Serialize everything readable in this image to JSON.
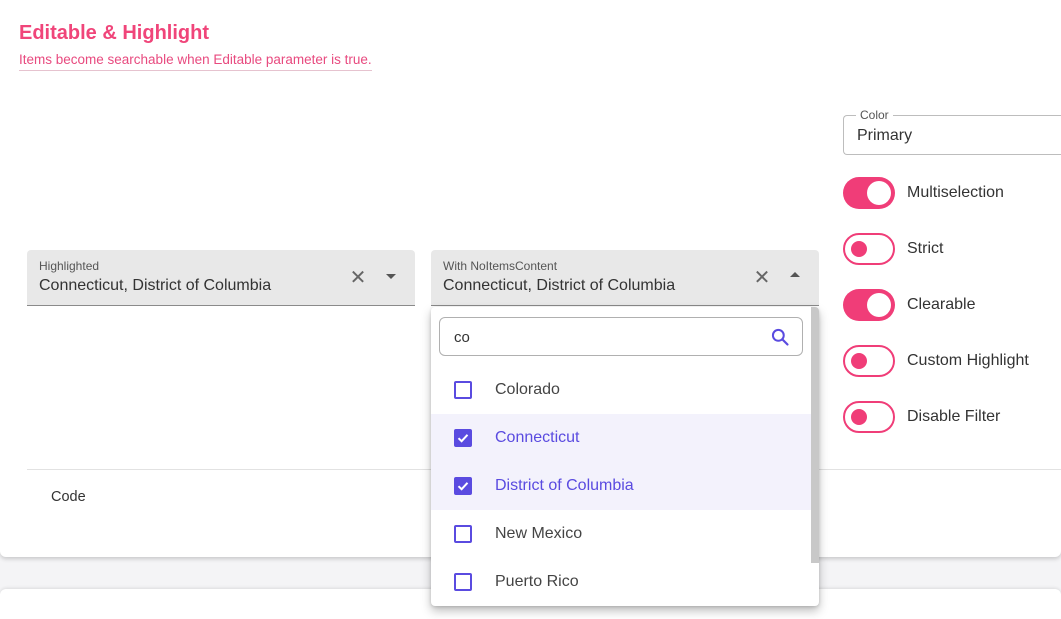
{
  "header": {
    "title": "Editable & Highlight",
    "subtitle": "Items become searchable when Editable parameter is true."
  },
  "fields": {
    "highlighted": {
      "label": "Highlighted",
      "value": "Connecticut, District of Columbia"
    },
    "noitems": {
      "label": "With NoItemsContent",
      "value": "Connecticut, District of Columbia"
    }
  },
  "color_select": {
    "label": "Color",
    "value": "Primary"
  },
  "switches": [
    {
      "label": "Multiselection",
      "on": true
    },
    {
      "label": "Strict",
      "on": false
    },
    {
      "label": "Clearable",
      "on": true
    },
    {
      "label": "Custom Highlight",
      "on": false
    },
    {
      "label": "Disable Filter",
      "on": false
    }
  ],
  "footer": {
    "code_label": "Code"
  },
  "dropdown": {
    "search_value": "co",
    "items": [
      {
        "label": "Colorado",
        "checked": false
      },
      {
        "label": "Connecticut",
        "checked": true
      },
      {
        "label": "District of Columbia",
        "checked": true
      },
      {
        "label": "New Mexico",
        "checked": false
      },
      {
        "label": "Puerto Rico",
        "checked": false
      }
    ]
  },
  "colors": {
    "accent": "#f03d78",
    "primary": "#5a4be0",
    "title": "#f0457a"
  }
}
